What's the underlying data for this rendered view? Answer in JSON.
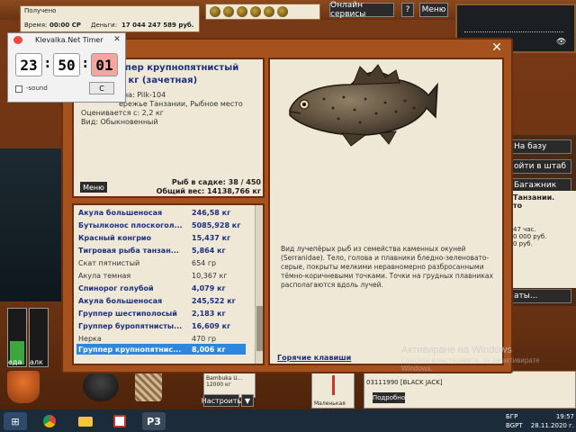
{
  "stats": {
    "received_label": "Получено",
    "time_label": "Время:",
    "time_value": "00:00 СР",
    "money_label": "Деньги:",
    "money_value": "17 044 247 589 руб."
  },
  "header_buttons": {
    "online": "Онлайн сервисы",
    "help": "?",
    "menu": "Меню"
  },
  "right_buttons": [
    "На базу",
    "ойти в штаб",
    "Багажник"
  ],
  "right_info": {
    "title": "Танзании.",
    "line2": "то",
    "line3": "47 час.",
    "line4": "0 000 руб.",
    "line5": "0 руб.",
    "footer": "аты..."
  },
  "dialog": {
    "close": "✕",
    "fish_name": "ппер крупнопятнистый",
    "fish_weight": "6 кг (зачетная)",
    "bait": "ана: Pilk-104",
    "place": "ережье Танзании, Рыбное место",
    "value": "Оценивается с: 2,2 кг",
    "kind": "Вид: Обыкновенный",
    "menu": "Меню",
    "sadok": "Рыб в садке: 38 / 450",
    "total": "Общий вес: 14138,766 кг",
    "description": "Вид лучепёрых рыб из семейства каменных окуней (Serranidae). Тело, голова и плавники бледно-зеленовато-серые, покрыты мелкими неравномерно разбросанными тёмно-коричневыми точками.  Точки на грудных плавниках располагаются вдоль лучей.",
    "hotkeys": "Горячие клавиши"
  },
  "catch_list": [
    {
      "name": "Акула большеносая",
      "weight": "246,58 кг",
      "style": "bold"
    },
    {
      "name": "Бутылконос плоскогол...",
      "weight": "5085,928 кг",
      "style": "bold"
    },
    {
      "name": "Красный конгрио",
      "weight": "15,437 кг",
      "style": "bold"
    },
    {
      "name": "Тигровая рыба танзан...",
      "weight": "5,864 кг",
      "style": "bold"
    },
    {
      "name": "Скат пятнистый",
      "weight": "654 гр",
      "style": "plain"
    },
    {
      "name": "Акула темная",
      "weight": "10,367 кг",
      "style": "plain"
    },
    {
      "name": "Спинорог голубой",
      "weight": "4,079 кг",
      "style": "bold"
    },
    {
      "name": "Акула большеносая",
      "weight": "245,522 кг",
      "style": "bold"
    },
    {
      "name": "Группер шестиполосый",
      "weight": "2,183 кг",
      "style": "bold"
    },
    {
      "name": "Группер буропятнисты...",
      "weight": "16,609 кг",
      "style": "bold"
    },
    {
      "name": "Нерка",
      "weight": "470 гр",
      "style": "plain"
    },
    {
      "name": "Группер крупнопятнис...",
      "weight": "8,006 кг",
      "style": "sel"
    }
  ],
  "timer": {
    "title": "Klevalka.Net Timer",
    "close": "✕",
    "hours": "23",
    "minutes": "50",
    "seconds": "01",
    "sound": "-sound",
    "c_button": "C"
  },
  "gauges": {
    "food": "еда",
    "alc": "алк"
  },
  "bottom": {
    "bambuka": "Bambuka U...",
    "bambuka_weight": "12000 кг",
    "nastroit": "Настроить",
    "arrow": "▼",
    "float": "Маленькая",
    "player": "03111990 [BLACK JACK]",
    "podrobno": "Подробно"
  },
  "activation": {
    "title": "Активиране на Windows",
    "sub": "Отидете в настройките, за да активирате Windows."
  },
  "taskbar": {
    "lang": "БГР",
    "lang2": "BGPT",
    "time": "19:57",
    "date": "28.11.2020 г."
  }
}
